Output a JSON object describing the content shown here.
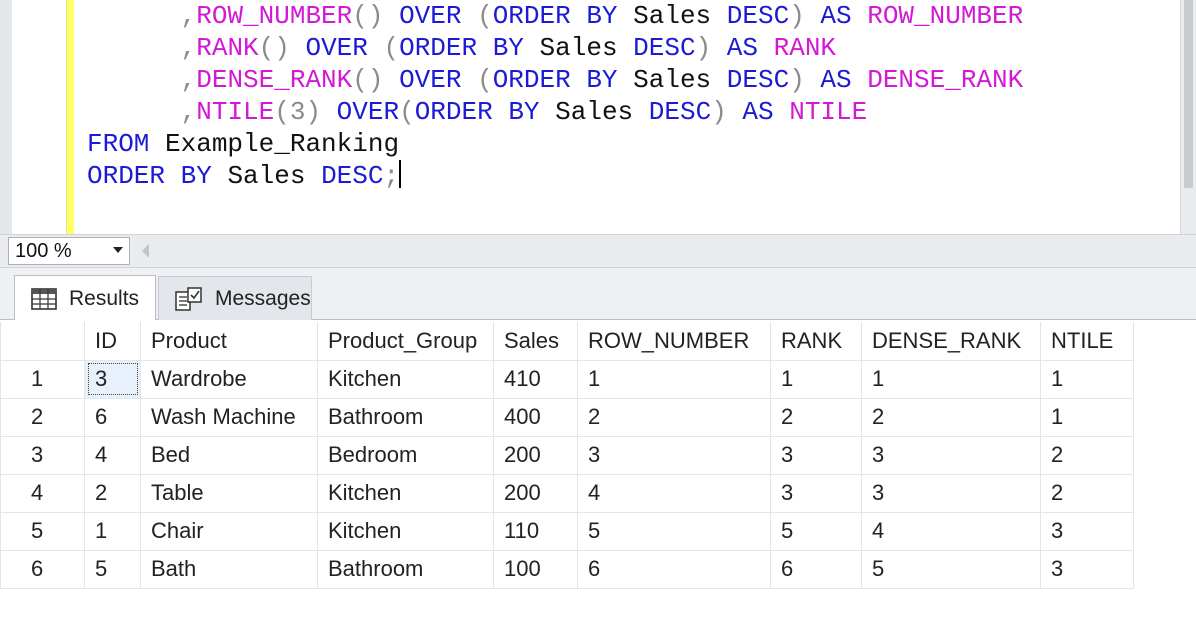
{
  "editor": {
    "code_lines": [
      [
        {
          "t": "      ",
          "c": "txt"
        },
        {
          "t": ",",
          "c": "op"
        },
        {
          "t": "ROW_NUMBER",
          "c": "fn"
        },
        {
          "t": "() ",
          "c": "op"
        },
        {
          "t": "OVER ",
          "c": "kw"
        },
        {
          "t": "(",
          "c": "op"
        },
        {
          "t": "ORDER BY ",
          "c": "kw"
        },
        {
          "t": "Sales ",
          "c": "txt"
        },
        {
          "t": "DESC",
          "c": "kw"
        },
        {
          "t": ") ",
          "c": "op"
        },
        {
          "t": "AS ",
          "c": "kw"
        },
        {
          "t": "ROW_NUMBER",
          "c": "fn"
        }
      ],
      [
        {
          "t": "      ",
          "c": "txt"
        },
        {
          "t": ",",
          "c": "op"
        },
        {
          "t": "RANK",
          "c": "fn"
        },
        {
          "t": "() ",
          "c": "op"
        },
        {
          "t": "OVER ",
          "c": "kw"
        },
        {
          "t": "(",
          "c": "op"
        },
        {
          "t": "ORDER BY ",
          "c": "kw"
        },
        {
          "t": "Sales ",
          "c": "txt"
        },
        {
          "t": "DESC",
          "c": "kw"
        },
        {
          "t": ") ",
          "c": "op"
        },
        {
          "t": "AS ",
          "c": "kw"
        },
        {
          "t": "RANK",
          "c": "fn"
        }
      ],
      [
        {
          "t": "      ",
          "c": "txt"
        },
        {
          "t": ",",
          "c": "op"
        },
        {
          "t": "DENSE_RANK",
          "c": "fn"
        },
        {
          "t": "() ",
          "c": "op"
        },
        {
          "t": "OVER ",
          "c": "kw"
        },
        {
          "t": "(",
          "c": "op"
        },
        {
          "t": "ORDER BY ",
          "c": "kw"
        },
        {
          "t": "Sales ",
          "c": "txt"
        },
        {
          "t": "DESC",
          "c": "kw"
        },
        {
          "t": ") ",
          "c": "op"
        },
        {
          "t": "AS ",
          "c": "kw"
        },
        {
          "t": "DENSE_RANK",
          "c": "fn"
        }
      ],
      [
        {
          "t": "      ",
          "c": "txt"
        },
        {
          "t": ",",
          "c": "op"
        },
        {
          "t": "NTILE",
          "c": "fn"
        },
        {
          "t": "(3) ",
          "c": "op"
        },
        {
          "t": "OVER",
          "c": "kw"
        },
        {
          "t": "(",
          "c": "op"
        },
        {
          "t": "ORDER BY ",
          "c": "kw"
        },
        {
          "t": "Sales ",
          "c": "txt"
        },
        {
          "t": "DESC",
          "c": "kw"
        },
        {
          "t": ") ",
          "c": "op"
        },
        {
          "t": "AS ",
          "c": "kw"
        },
        {
          "t": "NTILE",
          "c": "fn"
        }
      ],
      [
        {
          "t": "FROM ",
          "c": "kw"
        },
        {
          "t": "Example_Ranking",
          "c": "txt"
        }
      ],
      [
        {
          "t": "ORDER BY ",
          "c": "kw"
        },
        {
          "t": "Sales ",
          "c": "txt"
        },
        {
          "t": "DESC",
          "c": "kw"
        },
        {
          "t": ";",
          "c": "op"
        }
      ]
    ]
  },
  "zoom": {
    "value": "100 %"
  },
  "tabs": {
    "results_label": "Results",
    "messages_label": "Messages"
  },
  "grid": {
    "columns": [
      "",
      "ID",
      "Product",
      "Product_Group",
      "Sales",
      "ROW_NUMBER",
      "RANK",
      "DENSE_RANK",
      "NTILE"
    ],
    "rows": [
      [
        "1",
        "3",
        "Wardrobe",
        "Kitchen",
        "410",
        "1",
        "1",
        "1",
        "1"
      ],
      [
        "2",
        "6",
        "Wash Machine",
        "Bathroom",
        "400",
        "2",
        "2",
        "2",
        "1"
      ],
      [
        "3",
        "4",
        "Bed",
        "Bedroom",
        "200",
        "3",
        "3",
        "3",
        "2"
      ],
      [
        "4",
        "2",
        "Table",
        "Kitchen",
        "200",
        "4",
        "3",
        "3",
        "2"
      ],
      [
        "5",
        "1",
        "Chair",
        "Kitchen",
        "110",
        "5",
        "5",
        "4",
        "3"
      ],
      [
        "6",
        "5",
        "Bath",
        "Bathroom",
        "100",
        "6",
        "6",
        "5",
        "3"
      ]
    ]
  }
}
